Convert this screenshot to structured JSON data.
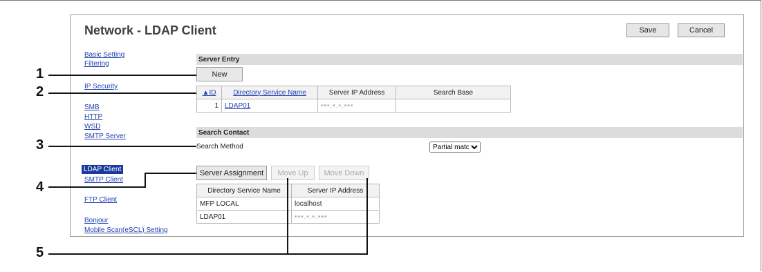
{
  "page": {
    "title": "Network - LDAP Client",
    "save_label": "Save",
    "cancel_label": "Cancel"
  },
  "sidebar": {
    "items": [
      {
        "label": "Basic Setting"
      },
      {
        "label": "Filtering"
      },
      {
        "label": "IP Security"
      },
      {
        "label": "SMB"
      },
      {
        "label": "HTTP"
      },
      {
        "label": "WSD"
      },
      {
        "label": "SMTP Server"
      },
      {
        "label": "LDAP Client"
      },
      {
        "label": "SMTP Client"
      },
      {
        "label": "FTP Client"
      },
      {
        "label": "Bonjour"
      },
      {
        "label": "Mobile Scan(eSCL) Setting"
      }
    ]
  },
  "server_entry": {
    "heading": "Server Entry",
    "new_label": "New",
    "columns": [
      "▲ID",
      "Directory Service Name",
      "Server IP Address",
      "Search Base"
    ],
    "rows": [
      {
        "id": "1",
        "name": "LDAP01",
        "ip": "•••.•.•.•••",
        "base": ""
      }
    ]
  },
  "search_contact": {
    "heading": "Search Contact",
    "method_label": "Search Method",
    "method_value": "Partial match"
  },
  "assignment": {
    "server_assignment_label": "Server Assignment",
    "move_up_label": "Move Up",
    "move_down_label": "Move Down",
    "columns": [
      "Directory Service Name",
      "Server IP Address"
    ],
    "rows": [
      {
        "name": "MFP LOCAL",
        "ip": "localhost"
      },
      {
        "name": "LDAP01",
        "ip": "•••.•.•.•••"
      }
    ]
  },
  "callouts": [
    "1",
    "2",
    "3",
    "4",
    "5"
  ]
}
